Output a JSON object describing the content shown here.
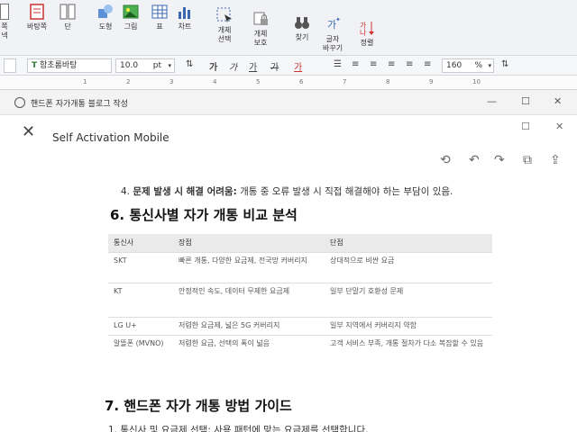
{
  "ribbon": {
    "items": [
      {
        "label": "쪽",
        "sub": "넥"
      },
      {
        "label": "바탕쪽",
        "sub": ""
      },
      {
        "label": "단",
        "sub": ""
      },
      {
        "label": "도형",
        "sub": ""
      },
      {
        "label": "그림",
        "sub": ""
      },
      {
        "label": "표",
        "sub": ""
      },
      {
        "label": "차트",
        "sub": ""
      },
      {
        "label": "개체",
        "sub": "선택"
      },
      {
        "label": "개체",
        "sub": "보호"
      },
      {
        "label": "찾기",
        "sub": ""
      },
      {
        "label": "글자",
        "sub": "바꾸기"
      },
      {
        "label": "정렬",
        "sub": ""
      }
    ]
  },
  "format_bar": {
    "font_name": "함초롬바탕",
    "font_size": "10.0",
    "unit": "pt",
    "bold": "가",
    "italic": "가",
    "underline": "가",
    "strike": "가",
    "color": "가",
    "zoom": "160",
    "zoom_unit": "%"
  },
  "ruler": [
    "1",
    "2",
    "3",
    "4",
    "5",
    "6",
    "7",
    "8",
    "9",
    "10"
  ],
  "window": {
    "title": "핸드폰 자가개통 블로그 작성",
    "header_title": "Self Activation Mobile"
  },
  "content": {
    "item4_label": "4.",
    "item4_bold": "문제 발생 시 해결 어려움:",
    "item4_text": "개통 중 오류 발생 시 직접 해결해야 하는 부담이 있음.",
    "heading6": "6. 통신사별 자가 개통 비교 분석",
    "table": {
      "headers": [
        "통신사",
        "장점",
        "단점"
      ],
      "rows": [
        [
          "SKT",
          "빠른 개통, 다양한 요금제, 전국망 커버리지",
          "상대적으로 비싼 요금"
        ],
        [
          "KT",
          "안정적인 속도, 데이터 무제한 요금제",
          "일부 단말기 호환성 문제"
        ],
        [
          "LG U+",
          "저렴한 요금제, 넓은 5G 커버리지",
          "일부 지역에서 커버리지 약함"
        ],
        [
          "알뜰폰 (MVNO)",
          "저렴한 요금, 선택의 폭이 넓음",
          "고객 서비스 부족, 개통 절차가 다소 복잡할 수 있음"
        ]
      ]
    },
    "heading7": "7. 핸드폰 자가 개통 방법 가이드",
    "item1_label": "1.",
    "item1_text": "통신사 및 요금제 선택: 사용 패턴에 맞는 요금제를 선택합니다."
  }
}
